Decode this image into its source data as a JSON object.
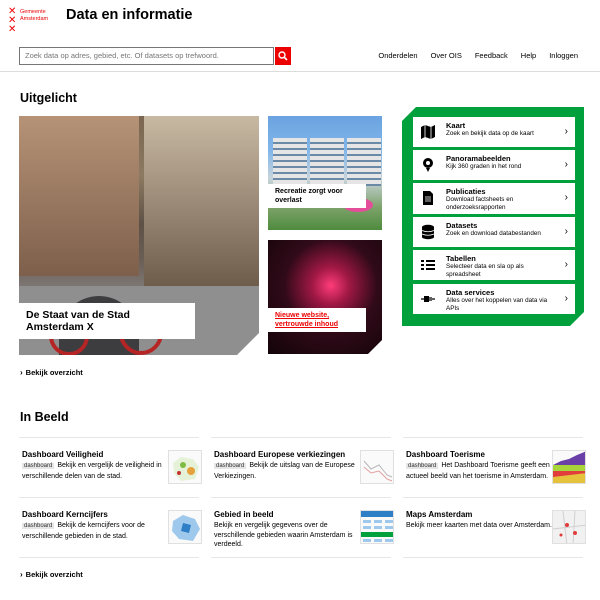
{
  "header": {
    "logo_text": [
      "Gemeente",
      "Amsterdam"
    ],
    "site_title": "Data en informatie",
    "search_placeholder": "Zoek data op adres, gebied, etc. Of datasets op trefwoord.",
    "nav": [
      "Onderdelen",
      "Over OIS",
      "Feedback",
      "Help",
      "Inloggen"
    ]
  },
  "featured": {
    "heading": "Uitgelicht",
    "main_caption": "De Staat van de Stad Amsterdam X",
    "side1_caption": "Recreatie zorgt voor overlast",
    "side2_caption": "Nieuwe website, vertrouwde inhoud",
    "overview_link": "Bekijk overzicht"
  },
  "panel": {
    "items": [
      {
        "title": "Kaart",
        "desc": "Zoek en bekijk data op de kaart",
        "icon": "map-icon"
      },
      {
        "title": "Panoramabeelden",
        "desc": "Kijk 360 graden in het rond",
        "icon": "panorama-icon"
      },
      {
        "title": "Publicaties",
        "desc": "Download factsheets en onderzoeksrapporten",
        "icon": "document-icon"
      },
      {
        "title": "Datasets",
        "desc": "Zoek en download databestanden",
        "icon": "database-icon"
      },
      {
        "title": "Tabellen",
        "desc": "Selecteer data en sla op als spreadsheet",
        "icon": "table-icon"
      },
      {
        "title": "Data services",
        "desc": "Alles over het koppelen van data via APIs",
        "icon": "plug-icon"
      }
    ]
  },
  "in_beeld": {
    "heading": "In Beeld",
    "tag": "dashboard",
    "cards": [
      {
        "title": "Dashboard Veiligheid",
        "tag": "dashboard",
        "desc": "Bekijk en vergelijk de veiligheid in verschillende delen van de stad."
      },
      {
        "title": "Dashboard Europese verkiezingen",
        "tag": "dashboard",
        "desc": "Bekijk de uitslag van de Europese Verkiezingen."
      },
      {
        "title": "Dashboard Toerisme",
        "tag": "dashboard",
        "desc": "Het Dashboard Toerisme geeft een actueel beeld van het toerisme in Amsterdam."
      },
      {
        "title": "Dashboard Kerncijfers",
        "tag": "dashboard",
        "desc": "Bekijk de kerncijfers voor de verschillende gebieden in de stad."
      },
      {
        "title": "Gebied in beeld",
        "tag": "",
        "desc": "Bekijk en vergelijk gegevens over de verschillende gebieden waarin Amsterdam is verdeeld."
      },
      {
        "title": "Maps Amsterdam",
        "tag": "",
        "desc": "Bekijk meer kaarten met data over Amsterdam."
      }
    ],
    "overview_link": "Bekijk overzicht"
  },
  "colors": {
    "brand_red": "#ec0000",
    "panel_green": "#00a03c"
  }
}
